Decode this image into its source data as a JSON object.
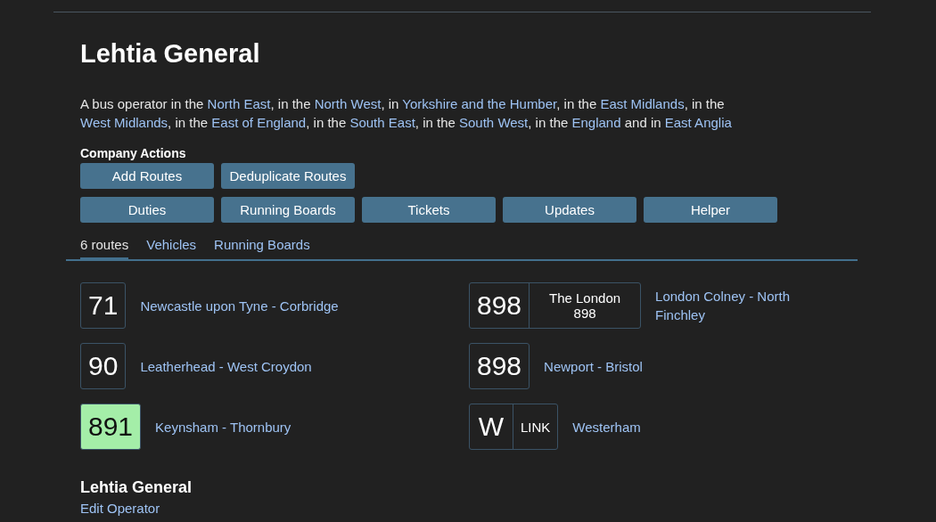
{
  "title": "Lehtia General",
  "description": [
    {
      "text": "A bus operator in the ",
      "link": false
    },
    {
      "text": "North East",
      "link": true
    },
    {
      "text": ", in the ",
      "link": false
    },
    {
      "text": "North West",
      "link": true
    },
    {
      "text": ", in ",
      "link": false
    },
    {
      "text": "Yorkshire and the Humber",
      "link": true
    },
    {
      "text": ", in the ",
      "link": false
    },
    {
      "text": "East Midlands",
      "link": true
    },
    {
      "text": ", in the ",
      "link": false
    },
    {
      "text": "West Midlands",
      "link": true
    },
    {
      "text": ", in the ",
      "link": false
    },
    {
      "text": "East of England",
      "link": true
    },
    {
      "text": ", in the ",
      "link": false
    },
    {
      "text": "South East",
      "link": true
    },
    {
      "text": ", in the ",
      "link": false
    },
    {
      "text": "South West",
      "link": true
    },
    {
      "text": ", in the ",
      "link": false
    },
    {
      "text": "England",
      "link": true
    },
    {
      "text": " and in ",
      "link": false
    },
    {
      "text": "East Anglia",
      "link": true
    }
  ],
  "actions": {
    "heading": "Company Actions",
    "rows": [
      [
        "Add Routes",
        "Deduplicate Routes"
      ],
      [
        "Duties",
        "Running Boards",
        "Tickets",
        "Updates",
        "Helper"
      ]
    ]
  },
  "tabs": [
    {
      "label": "6 routes",
      "selected": true
    },
    {
      "label": "Vehicles",
      "selected": false
    },
    {
      "label": "Running Boards",
      "selected": false
    }
  ],
  "routes": [
    {
      "number": "71",
      "destination": "Newcastle upon Tyne - Corbridge",
      "color": "#212121"
    },
    {
      "number": "898",
      "name": "The London 898",
      "destination": "London Colney - North Finchley",
      "color": "#212121"
    },
    {
      "number": "90",
      "destination": "Leatherhead - West Croydon",
      "color": "#212121"
    },
    {
      "number": "898",
      "destination": "Newport - Bristol",
      "color": "#212121"
    },
    {
      "number": "891",
      "destination": "Keynsham - Thornbury",
      "color": "#a4eea8"
    },
    {
      "number": "W",
      "name": "LINK",
      "destination": "Westerham",
      "color": "#212121"
    }
  ],
  "footer": {
    "title": "Lehtia General",
    "link": "Edit Operator"
  }
}
